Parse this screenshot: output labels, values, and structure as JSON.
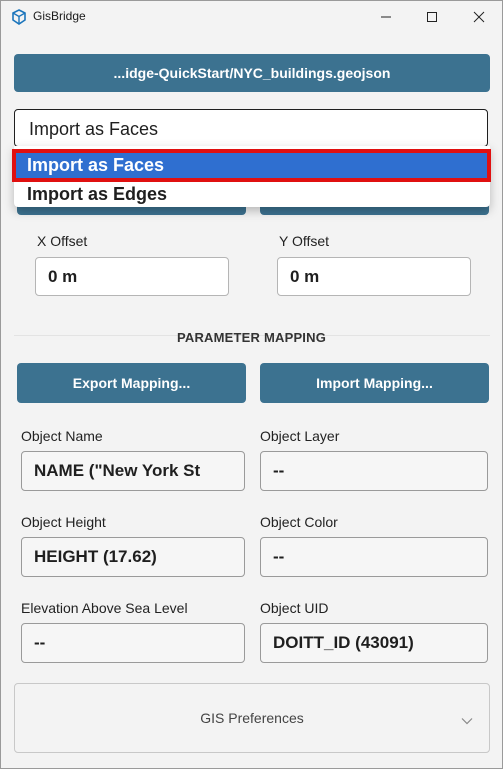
{
  "window": {
    "title": "GisBridge",
    "icon": "sketchup-cube-icon"
  },
  "file": {
    "path_label": "...idge-QuickStart/NYC_buildings.geojson"
  },
  "import_mode": {
    "selected_value": "Import as Faces",
    "options": [
      "Import as Faces",
      "Import as Edges"
    ],
    "highlighted_index": 0
  },
  "offsets": {
    "x_label": "X Offset",
    "x_value": "0 m",
    "y_label": "Y Offset",
    "y_value": "0 m"
  },
  "mapping": {
    "section_title": "PARAMETER MAPPING",
    "export_label": "Export Mapping...",
    "import_label": "Import Mapping...",
    "fields": {
      "object_name": {
        "label": "Object Name",
        "value": "NAME (\"New York St"
      },
      "object_layer": {
        "label": "Object Layer",
        "value": "--"
      },
      "object_height": {
        "label": "Object Height",
        "value": "HEIGHT (17.62)"
      },
      "object_color": {
        "label": "Object Color",
        "value": "--"
      },
      "elevation": {
        "label": "Elevation Above Sea Level",
        "value": "--"
      },
      "object_uid": {
        "label": "Object UID",
        "value": "DOITT_ID (43091)"
      }
    }
  },
  "preferences": {
    "label": "GIS Preferences",
    "icon": "chevron-down-icon"
  },
  "colors": {
    "accent": "#3c7290",
    "selection": "#2f6fd0",
    "highlight_border": "#e01010"
  }
}
